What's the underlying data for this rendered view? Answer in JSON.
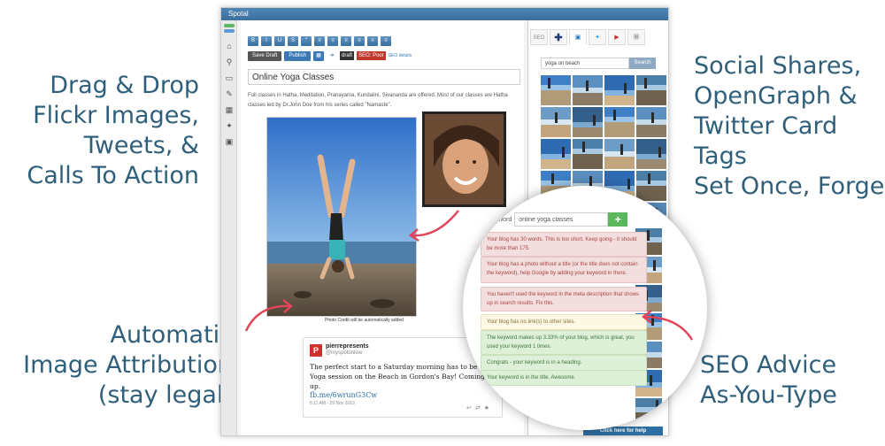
{
  "callouts": {
    "drag": [
      "Drag & Drop",
      "Flickr Images,",
      "Tweets, &",
      "Calls To Action"
    ],
    "attribution": [
      "Automatic",
      "Image Attribution",
      "(stay legal)"
    ],
    "social": [
      "Social Shares,",
      "OpenGraph &",
      "Twitter Card",
      "Tags",
      "Set Once, Forget"
    ],
    "seo": [
      "SEO Advice",
      "As-You-Type"
    ]
  },
  "window": {
    "title": "Spotal"
  },
  "toolbar": {
    "format_buttons": [
      "B",
      "I",
      "U",
      "S",
      "“",
      "≡",
      "≡",
      "≡",
      "≡",
      "≡",
      "≡"
    ],
    "save_draft": "Save Draft",
    "publish": "Publish",
    "status_draft": "draft",
    "seo_status": "SEO: Poor",
    "seo_details": "SEO details"
  },
  "editor": {
    "post_title": "Online Yoga Classes",
    "body_text": "Full classes in Hatha, Meditation, Pranayama, Kundalini, Sivananda are offered. Most of our classes are Hatha classes led by Dr.John Doe from his series called \"Namaste\".",
    "photo_credit": "Photo Credit will be automatically added"
  },
  "tweet": {
    "user": "pierrepresents",
    "handle": "@myspotonline",
    "avatar_letter": "P",
    "text": "The perfect start to a Saturday morning has to be a FR Yoga session on the Beach in Gordon's Bay! Coming up.",
    "link": "fb.me/6wrunG3Cw",
    "time": "6:11 AM - 29 Nov 2013"
  },
  "panel": {
    "tab_label": "SEO",
    "search_value": "yoga on beach",
    "search_button": "Search",
    "help": "Click here for help"
  },
  "seo": {
    "keyword_label": "Keyword",
    "keyword_value": "online yoga classes",
    "add_label": "+",
    "advice": [
      {
        "level": "bad",
        "text": "Your blog has 30 words. This is too short. Keep going - it should be more than 175."
      },
      {
        "level": "bad",
        "text": "Your blog has a photo without a title (or the title does not contain the keyword), help Google by adding your keyword in there."
      },
      {
        "level": "bad",
        "text": "You haven't used the keyword in the meta description that shows up in search results. Fix this."
      },
      {
        "level": "warn",
        "text": "Your blog has no link(s) to other sites."
      },
      {
        "level": "good",
        "text": "The keyword makes up 3.33% of your blog, which is great, you used your keyword 1 times."
      },
      {
        "level": "good",
        "text": "Congrats - your keyword is in a heading."
      },
      {
        "level": "good",
        "text": "Your keyword is in the title. Awesome."
      }
    ]
  },
  "colors": {
    "callout_text": "#2f5f7a",
    "arrow": "#e0455a",
    "accent_blue": "#3a78b8"
  }
}
